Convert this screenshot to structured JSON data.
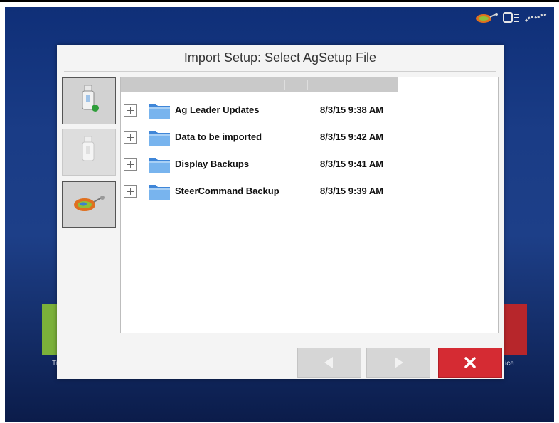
{
  "dialog": {
    "title": "Import Setup: Select AgSetup File"
  },
  "sources": [
    {
      "name": "usb-drive-connected",
      "state": "selected"
    },
    {
      "name": "usb-drive",
      "state": "disabled"
    },
    {
      "name": "agfiniti-cloud",
      "state": "enabled"
    }
  ],
  "files": [
    {
      "name": "Ag Leader Updates",
      "date": "8/3/15 9:38 AM"
    },
    {
      "name": "Data to be imported",
      "date": "8/3/15 9:42 AM"
    },
    {
      "name": "Display Backups",
      "date": "8/3/15 9:41 AM"
    },
    {
      "name": "SteerCommand Backup",
      "date": "8/3/15 9:39 AM"
    }
  ],
  "background": {
    "left_tile_label": "Ti",
    "right_tile_label": "ice"
  },
  "buttons": {
    "back": "back-arrow",
    "forward": "forward-arrow",
    "cancel": "close-x"
  },
  "colors": {
    "accent_cancel": "#d52b33",
    "folder_blue": "#4f95dc",
    "background_blue": "#1a3c86"
  }
}
